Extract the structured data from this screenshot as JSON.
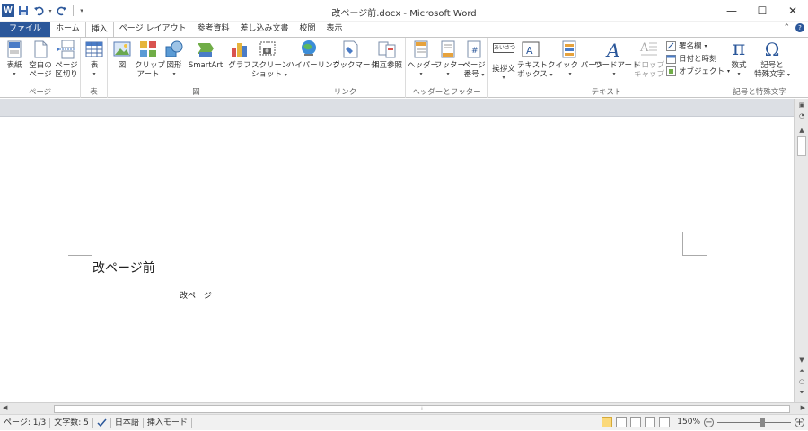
{
  "window": {
    "title": "改ページ前.docx - Microsoft Word",
    "app_logo": "W",
    "controls": {
      "minimize": "—",
      "maximize": "☐",
      "close": "✕"
    }
  },
  "quick_access": {
    "icons": [
      "word-logo-icon",
      "save-icon",
      "undo-icon",
      "redo-icon",
      "customize-qat-icon"
    ]
  },
  "tabs": [
    {
      "label": "ファイル",
      "kind": "file"
    },
    {
      "label": "ホーム"
    },
    {
      "label": "挿入",
      "active": true
    },
    {
      "label": "ページ レイアウト"
    },
    {
      "label": "参考資料"
    },
    {
      "label": "差し込み文書"
    },
    {
      "label": "校閲"
    },
    {
      "label": "表示"
    }
  ],
  "ribbon": {
    "groups": {
      "pages": "ページ",
      "tables": "表",
      "illustrations": "図",
      "links": "リンク",
      "header_footer": "ヘッダーとフッター",
      "text": "テキスト",
      "symbols": "記号と特殊文字"
    },
    "buttons": {
      "cover_page": "表紙",
      "blank_page_1": "空白の",
      "blank_page_2": "ページ",
      "page_break_1": "ページ",
      "page_break_2": "区切り",
      "table": "表",
      "picture": "図",
      "clipart_1": "クリップ",
      "clipart_2": "アート",
      "shapes": "図形",
      "smartart": "SmartArt",
      "chart": "グラフ",
      "screenshot_1": "スクリーン",
      "screenshot_2": "ショット",
      "hyperlink": "ハイパーリンク",
      "bookmark": "ブックマーク",
      "cross_ref": "相互参照",
      "header": "ヘッダー",
      "footer": "フッター",
      "page_number_1": "ページ",
      "page_number_2": "番号",
      "greeting_1": "挨拶文",
      "textbox_1": "テキスト",
      "textbox_2": "ボックス",
      "quickparts": "クイック パーツ",
      "wordart": "ワードアート",
      "dropcap_1": "ドロップ",
      "dropcap_2": "キャップ",
      "signature_line": "署名欄",
      "date_time": "日付と時刻",
      "object": "オブジェクト",
      "equation": "数式",
      "symbol_1": "記号と",
      "symbol_2": "特殊文字"
    },
    "greeting_icon_text": "あいさつ"
  },
  "document": {
    "text": "改ページ前",
    "page_break_label": "改ページ"
  },
  "statusbar": {
    "page": "ページ: 1/3",
    "words": "文字数: 5",
    "language": "日本語",
    "mode": "挿入モード",
    "zoom": "150%",
    "zoom_minus": "−",
    "zoom_plus": "+"
  },
  "colors": {
    "file_tab": "#2b579a",
    "ruler_band": "#dcdfe4"
  }
}
